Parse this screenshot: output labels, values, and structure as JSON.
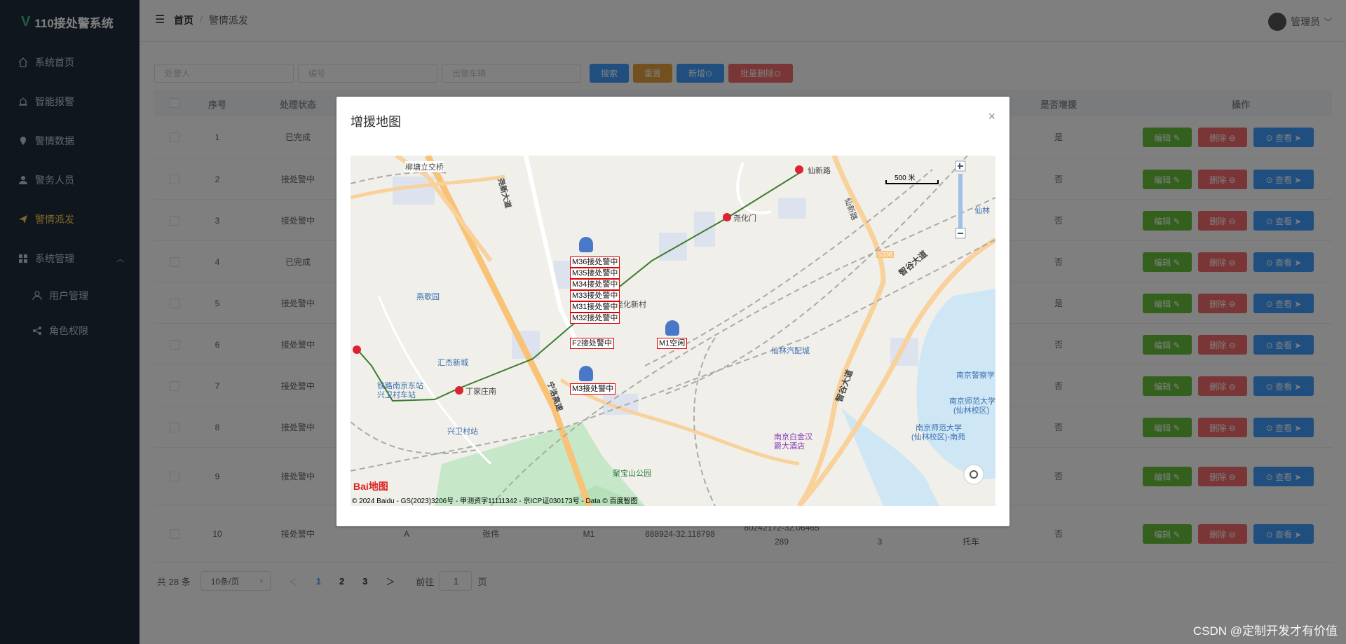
{
  "app": {
    "title": "110接处警系统",
    "logo_mark": "V"
  },
  "sidebar": {
    "items": [
      {
        "label": "系统首页",
        "icon": "home-icon"
      },
      {
        "label": "智能报警",
        "icon": "alarm-icon"
      },
      {
        "label": "警情数据",
        "icon": "location-icon"
      },
      {
        "label": "警务人员",
        "icon": "user-icon"
      },
      {
        "label": "警情派发",
        "icon": "send-icon",
        "active": true
      },
      {
        "label": "系统管理",
        "icon": "grid-icon"
      },
      {
        "label": "用户管理",
        "icon": "user-icon"
      },
      {
        "label": "角色权限",
        "icon": "share-icon"
      }
    ],
    "active_color": "#ffd04b"
  },
  "header": {
    "breadcrumb": [
      "首页",
      "警情派发"
    ],
    "user": "管理员"
  },
  "search": {
    "placeholder_handler": "处警人",
    "placeholder_number": "编号",
    "placeholder_vehicle": "出警车辆",
    "buttons": {
      "search": "搜索",
      "reset": "重置",
      "add": "新增⊙",
      "batch_delete": "批量删除⊙"
    }
  },
  "table": {
    "headers": {
      "index": "序号",
      "status": "处理状态",
      "backup": "是否增援",
      "actions": "操作"
    },
    "rows": [
      {
        "index": "1",
        "status": "已完成",
        "backup": "是"
      },
      {
        "index": "2",
        "status": "接处警中",
        "backup": "否"
      },
      {
        "index": "3",
        "status": "接处警中",
        "backup": "否"
      },
      {
        "index": "4",
        "status": "已完成",
        "backup": "否"
      },
      {
        "index": "5",
        "status": "接处警中",
        "backup": "是"
      },
      {
        "index": "6",
        "status": "接处警中",
        "backup": "否"
      },
      {
        "index": "7",
        "status": "接处警中",
        "backup": "否"
      },
      {
        "index": "8",
        "status": "接处警中",
        "backup": "否"
      },
      {
        "index": "9",
        "status": "接处警中",
        "backup": "否"
      },
      {
        "index": "10",
        "status": "接处警中",
        "backup": "否",
        "level": "A",
        "handler": "张伟",
        "vehicle": "M1",
        "coord1": "888924-32.118798",
        "coord2": "80242172-32.06465",
        "coord2b": "289",
        "time_tail": "3",
        "vehicle_type": "托车"
      }
    ],
    "action_labels": {
      "edit": "编辑 ✎",
      "delete": "删除 ⊖",
      "view": "⊙ 查看 ➤"
    }
  },
  "pagination": {
    "total": "共 28 条",
    "page_size": "10条/页",
    "pages": [
      "1",
      "2",
      "3"
    ],
    "current": "1",
    "goto_prefix": "前往",
    "goto_value": "1",
    "goto_suffix": "页"
  },
  "dialog": {
    "title": "增援地图",
    "close": "×"
  },
  "map": {
    "scale": "500 米",
    "labels": [
      "柳塘立交桥",
      "尧新大道",
      "仙新路",
      "尧化门",
      "仙新路",
      "S338",
      "智谷大道",
      "燕歌园",
      "尧化新村",
      "汇杰新城",
      "仙林汽配城",
      "铁路南京东站",
      "兴卫村车站",
      "丁家庄南",
      "宁洛高速",
      "兴卫村站",
      "南京警察学",
      "南京师范大学",
      "(仙林校区)",
      "南京师范大学",
      "(仙林校区)-南苑",
      "南京白金汉",
      "爵大酒店",
      "聚宝山公园",
      "智谷大道",
      "仙林"
    ],
    "police": [
      "M36接处警中",
      "M35接处警中",
      "M34接处警中",
      "M33接处警中",
      "M31接处警中",
      "M32接处警中",
      "F2接处警中",
      "M1空闲",
      "M3接处警中"
    ],
    "copyright": "© 2024 Baidu - GS(2023)3206号 - 甲测资字11111342 - 京ICP证030173号 - Data © 百度智图",
    "logo": "Bai地图"
  },
  "watermark": "CSDN @定制开发才有价值",
  "colors": {
    "sidebar_bg": "#1f2d3d",
    "primary": "#409eff",
    "success": "#67c23a",
    "warning": "#e6a23c",
    "danger": "#f56c6c"
  }
}
